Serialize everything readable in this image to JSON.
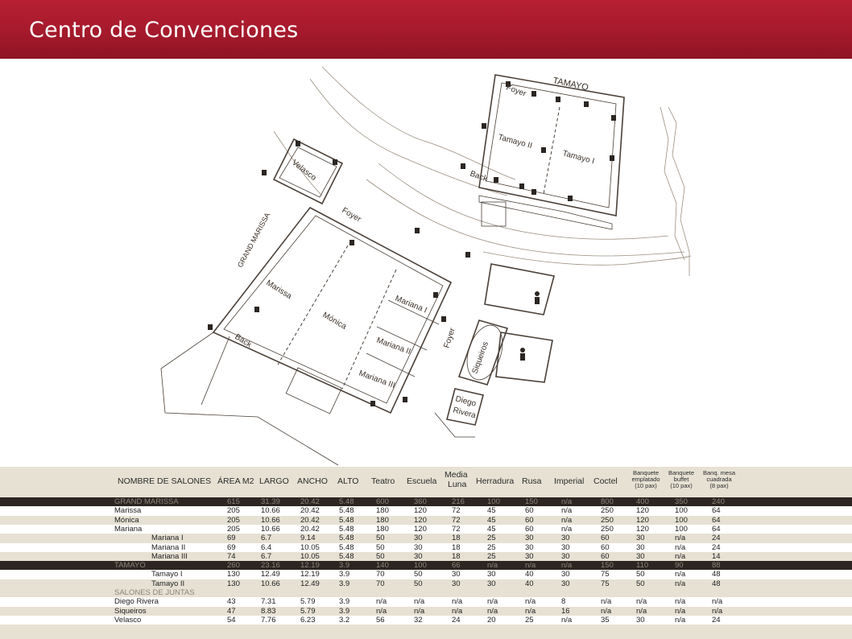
{
  "header": {
    "title": "Centro de Convenciones"
  },
  "plan": {
    "labels": {
      "tamayo": "TAMAYO",
      "foyer_top": "Foyer",
      "tamayo_ii": "Tamayo II",
      "tamayo_i": "Tamayo I",
      "back_top": "Back",
      "velasco": "Velasco",
      "foyer_mid": "Foyer",
      "grand_marissa": "GRAND MARISSA",
      "marissa": "Marissa",
      "monica": "Mónica",
      "mariana_i": "Mariana I",
      "mariana_ii": "Mariana II",
      "mariana_iii": "Mariana III",
      "back_left": "Back",
      "foyer_right": "Foyer",
      "siqueiros": "Siqueiros",
      "diego_rivera_1": "Diego",
      "diego_rivera_2": "Rivera"
    }
  },
  "table": {
    "headers": {
      "name": "NOMBRE DE SALONES",
      "area": "ÁREA M2",
      "largo": "LARGO",
      "ancho": "ANCHO",
      "alto": "ALTO",
      "teatro": "Teatro",
      "escuela": "Escuela",
      "media_1": "Media",
      "media_2": "Luna",
      "herradura": "Herradura",
      "rusa": "Rusa",
      "imperial": "Imperial",
      "coctel": "Coctel",
      "bq_emp_1": "Banquete",
      "bq_emp_2": "emplatado",
      "bq_emp_3": "(10 pax)",
      "bq_buf_1": "Banquete",
      "bq_buf_2": "buffet",
      "bq_buf_3": "(10 pax)",
      "bq_mesa_1": "Banq. mesa",
      "bq_mesa_2": "cuadrada",
      "bq_mesa_3": "(8 pax)"
    },
    "rows": [
      {
        "style": "sec",
        "indent": false,
        "cells": [
          "GRAND MARISSA",
          "615",
          "31.39",
          "20.42",
          "5.48",
          "600",
          "360",
          "216",
          "100",
          "150",
          "n/a",
          "800",
          "400",
          "350",
          "240"
        ]
      },
      {
        "style": "white",
        "indent": false,
        "cells": [
          "Marissa",
          "205",
          "10.66",
          "20.42",
          "5.48",
          "180",
          "120",
          "72",
          "45",
          "60",
          "n/a",
          "250",
          "120",
          "100",
          "64"
        ]
      },
      {
        "style": "tan",
        "indent": false,
        "cells": [
          "Mónica",
          "205",
          "10.66",
          "20.42",
          "5.48",
          "180",
          "120",
          "72",
          "45",
          "60",
          "n/a",
          "250",
          "120",
          "100",
          "64"
        ]
      },
      {
        "style": "white",
        "indent": false,
        "cells": [
          "Mariana",
          "205",
          "10.66",
          "20.42",
          "5.48",
          "180",
          "120",
          "72",
          "45",
          "60",
          "n/a",
          "250",
          "120",
          "100",
          "64"
        ]
      },
      {
        "style": "tan",
        "indent": true,
        "cells": [
          "Mariana I",
          "69",
          "6.7",
          "9.14",
          "5.48",
          "50",
          "30",
          "18",
          "25",
          "30",
          "30",
          "60",
          "30",
          "n/a",
          "24"
        ]
      },
      {
        "style": "white",
        "indent": true,
        "cells": [
          "Mariana II",
          "69",
          "6.4",
          "10.05",
          "5.48",
          "50",
          "30",
          "18",
          "25",
          "30",
          "30",
          "60",
          "30",
          "n/a",
          "24"
        ]
      },
      {
        "style": "tan",
        "indent": true,
        "cells": [
          "Mariana III",
          "74",
          "6.7",
          "10.05",
          "5.48",
          "50",
          "30",
          "18",
          "25",
          "30",
          "30",
          "60",
          "30",
          "n/a",
          "14"
        ]
      },
      {
        "style": "sec",
        "indent": false,
        "cells": [
          "TAMAYO",
          "260",
          "23.16",
          "12.19",
          "3.9",
          "140",
          "100",
          "66",
          "n/a",
          "n/a",
          "n/a",
          "150",
          "110",
          "90",
          "88"
        ]
      },
      {
        "style": "white",
        "indent": true,
        "cells": [
          "Tamayo I",
          "130",
          "12.49",
          "12.19",
          "3.9",
          "70",
          "50",
          "30",
          "30",
          "40",
          "30",
          "75",
          "50",
          "n/a",
          "48"
        ]
      },
      {
        "style": "tan",
        "indent": true,
        "cells": [
          "Tamayo II",
          "130",
          "10.66",
          "12.49",
          "3.9",
          "70",
          "50",
          "30",
          "30",
          "40",
          "30",
          "75",
          "50",
          "n/a",
          "48"
        ]
      },
      {
        "style": "seclight",
        "indent": false,
        "cells": [
          "SALONES DE JUNTAS",
          "",
          "",
          "",
          "",
          "",
          "",
          "",
          "",
          "",
          "",
          "",
          "",
          "",
          ""
        ]
      },
      {
        "style": "white",
        "indent": false,
        "cells": [
          "Diego Rivera",
          "43",
          "7.31",
          "5.79",
          "3.9",
          "n/a",
          "n/a",
          "n/a",
          "n/a",
          "n/a",
          "8",
          "n/a",
          "n/a",
          "n/a",
          "n/a"
        ]
      },
      {
        "style": "tan",
        "indent": false,
        "cells": [
          "Siqueiros",
          "47",
          "8.83",
          "5.79",
          "3.9",
          "n/a",
          "n/a",
          "n/a",
          "n/a",
          "n/a",
          "16",
          "n/a",
          "n/a",
          "n/a",
          "n/a"
        ]
      },
      {
        "style": "white",
        "indent": false,
        "cells": [
          "Velasco",
          "54",
          "7.76",
          "6.23",
          "3.2",
          "56",
          "32",
          "24",
          "20",
          "25",
          "n/a",
          "35",
          "30",
          "n/a",
          "24"
        ]
      }
    ]
  }
}
